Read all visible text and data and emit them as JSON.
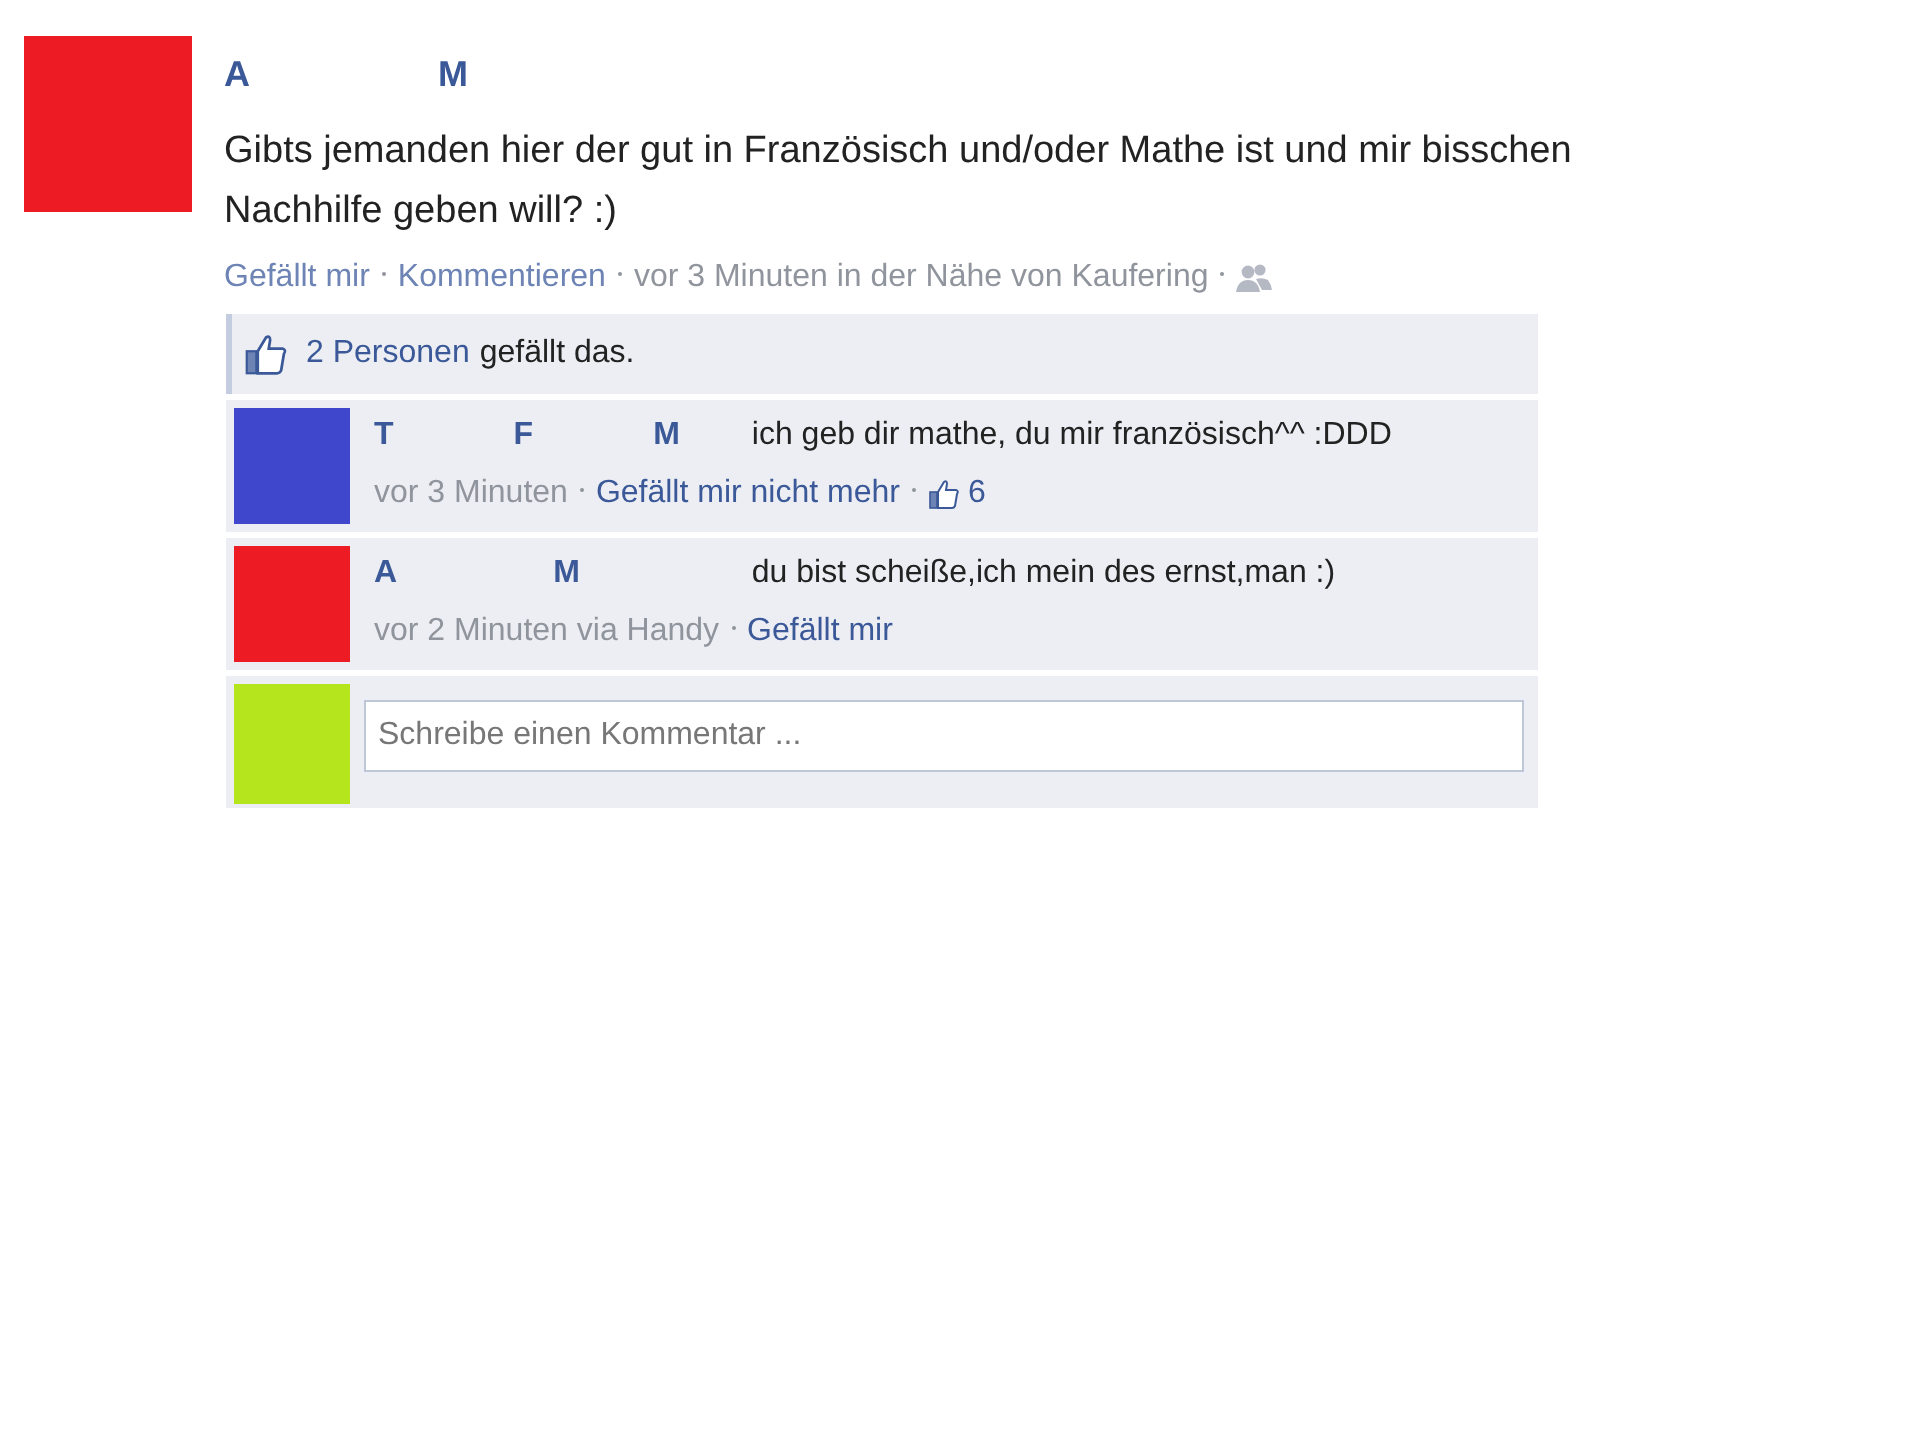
{
  "post": {
    "color": "#ed1c24",
    "author_parts": [
      "A",
      "M"
    ],
    "text": "Gibts jemanden hier der gut in Französisch und/oder Mathe ist und mir bisschen Nachhilfe geben will? :)",
    "actions": [
      "Gefällt mir",
      "Kommentieren"
    ],
    "meta": "vor 3 Minuten in der Nähe von Kaufering"
  },
  "likes": {
    "count_link": "2 Personen",
    "suffix": "gefällt das."
  },
  "comments": [
    {
      "color": "#3f48cc",
      "author_parts": [
        "T",
        "F",
        "M"
      ],
      "text": "ich geb dir mathe, du mir französisch^^ :DDD",
      "time": "vor 3 Minuten",
      "action": "Gefällt mir nicht mehr",
      "like_count": "6"
    },
    {
      "color": "#ed1c24",
      "author_parts": [
        "A",
        "M"
      ],
      "text": "du bist scheiße,ich mein des ernst,man :)",
      "time": "vor 2 Minuten via Handy",
      "action": "Gefällt mir"
    }
  ],
  "composer": {
    "color": "#b5e61d",
    "placeholder": "Schreibe einen Kommentar ..."
  }
}
